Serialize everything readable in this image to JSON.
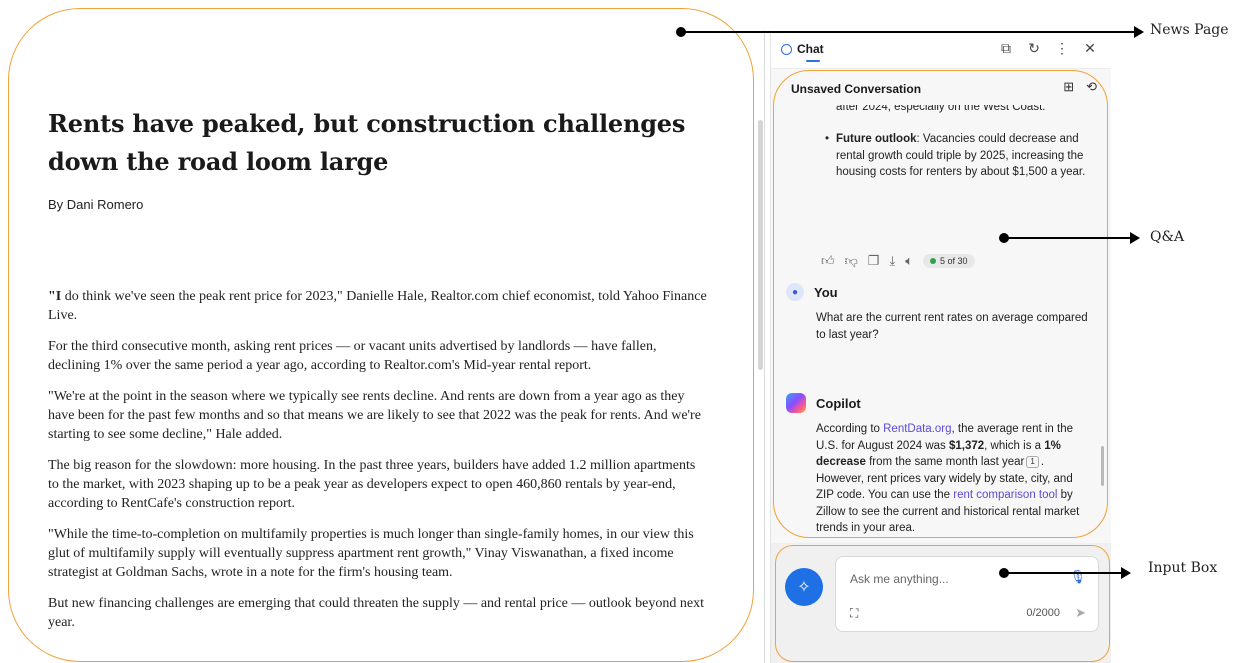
{
  "article": {
    "headline": "Rents have peaked, but construction challenges down the road loom large",
    "byline": "By Dani Romero",
    "p1_lead": "\"I",
    "p1_rest": " do think we've seen the peak rent price for 2023,\" Danielle Hale, Realtor.com chief economist, told Yahoo Finance Live.",
    "p2": "For the third consecutive month, asking rent prices — or vacant units advertised by landlords — have fallen, declining 1% over the same period a year ago, according to Realtor.com's Mid-year rental report.",
    "p3": "\"We're at the point in the season where we typically see rents decline. And rents are down from a year ago as they have been for the past few months and so that means we are likely to see that 2022 was the peak for rents. And we're starting to see some decline,\" Hale added.",
    "p4": "The big reason for the slowdown: more housing. In the past three years, builders have added 1.2 million apartments to the market, with 2023 shaping up to be a peak year as developers expect to open 460,860 rentals by year-end, according to RentCafe's construction report.",
    "p5": "\"While the time-to-completion on multifamily properties is much longer than single-family homes, in our view this glut of multifamily supply will eventually suppress apartment rent growth,\" Vinay Viswanathan, a fixed income strategist at Goldman Sachs, wrote in a note for the firm's housing team.",
    "p6": "But new financing challenges are emerging that could threaten the supply — and rental price — outlook beyond next year."
  },
  "panel": {
    "tab_label": "Chat",
    "header_icons": [
      "open-external-icon",
      "refresh-icon",
      "more-icon",
      "close-icon"
    ],
    "conversation_title": "Unsaved Conversation",
    "conversation_icons": [
      "add-chat-icon",
      "history-icon"
    ]
  },
  "messages": {
    "fragment": "after 2024, especially on the West Coast.",
    "bullet_label": "Future outlook",
    "bullet_text": ": Vacancies could decrease and rental growth could triple by 2025, increasing the housing costs for renters by about $1,500 a year.",
    "feedback_icons": [
      "thumbs-up-icon",
      "thumbs-down-icon",
      "copy-icon",
      "download-icon",
      "read-aloud-icon"
    ],
    "count": "5 of 30",
    "user_name": "You",
    "user_text": "What are the current rent rates on average compared to last year?",
    "bot_name": "Copilot",
    "bot_a": "According to ",
    "bot_link1": "RentData.org",
    "bot_b": ", the average rent in the U.S. for August 2024 was ",
    "bot_price": "$1,372",
    "bot_c": ", which is a ",
    "bot_decrease": "1% decrease",
    "bot_d": " from the same month last year",
    "bot_cite": "1",
    "bot_e": ". However, rent prices vary widely by state, city, and ZIP code. You can use the ",
    "bot_link2": "rent comparison tool",
    "bot_f": " by Zillow to see the current and historical rental market trends in your area."
  },
  "input": {
    "placeholder": "Ask me anything...",
    "value": "",
    "char_count": "0/2000"
  },
  "callouts": {
    "news_page": "News Page",
    "qa": "Q&A",
    "input_box": "Input Box"
  },
  "colors": {
    "accent": "#2f6fde",
    "highlight": "#f0a23a",
    "link": "#5b4bd6",
    "send_button": "#1f6fe5"
  }
}
